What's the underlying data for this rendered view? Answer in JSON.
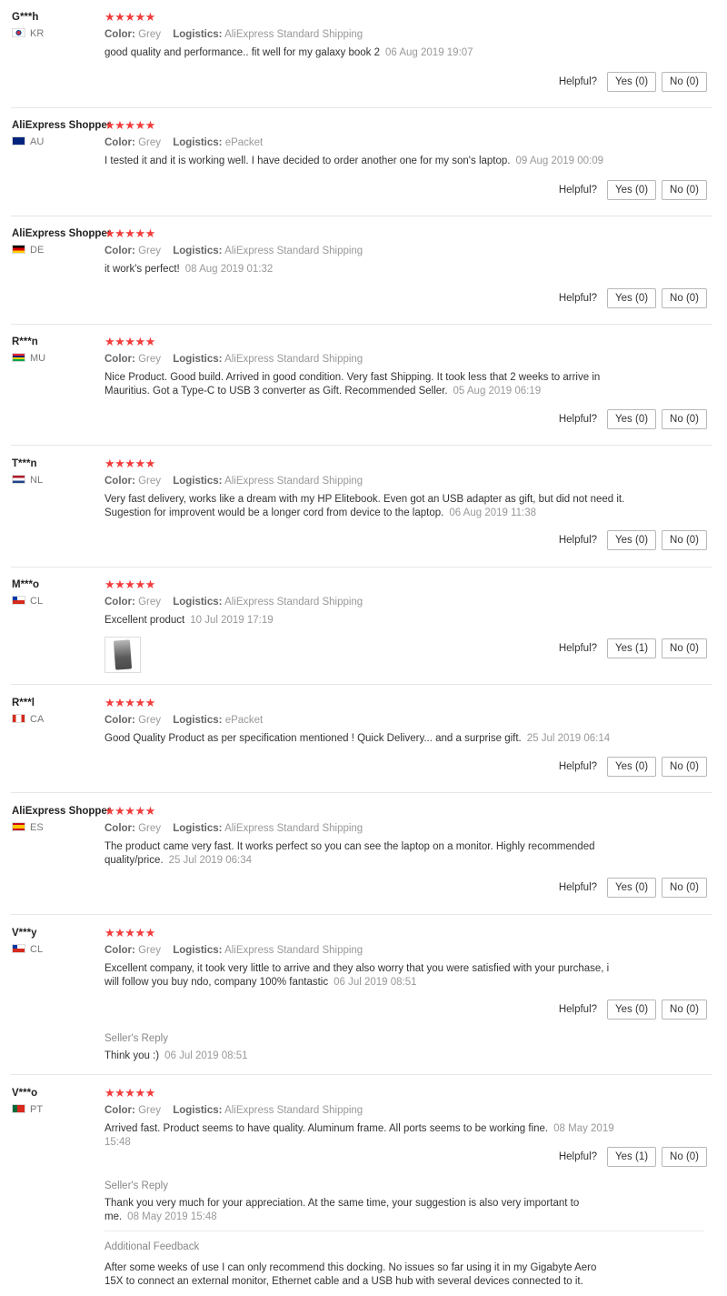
{
  "helpful_label": "Helpful?",
  "logistics_label": "Logistics:",
  "color_label": "Color:",
  "star_glyphs": "★★★★★",
  "reviews": [
    {
      "user": "G***h",
      "country": "KR",
      "flag": "kr",
      "stars": 5,
      "color": "Grey",
      "logistics": "AliExpress Standard Shipping",
      "text": "good quality and performance.. fit well for my galaxy book 2",
      "time": "06 Aug 2019 19:07",
      "yes": "Yes (0)",
      "no": "No (0)"
    },
    {
      "user": "AliExpress Shopper",
      "country": "AU",
      "flag": "au",
      "stars": 5,
      "color": "Grey",
      "logistics": "ePacket",
      "text": "I tested it and it is working well. I have decided to order another one for my son's laptop.",
      "time": "09 Aug 2019 00:09",
      "yes": "Yes (0)",
      "no": "No (0)"
    },
    {
      "user": "AliExpress Shopper",
      "country": "DE",
      "flag": "de",
      "stars": 5,
      "color": "Grey",
      "logistics": "AliExpress Standard Shipping",
      "text": "it work's perfect!",
      "time": "08 Aug 2019 01:32",
      "yes": "Yes (0)",
      "no": "No (0)"
    },
    {
      "user": "R***n",
      "country": "MU",
      "flag": "mu",
      "stars": 5,
      "color": "Grey",
      "logistics": "AliExpress Standard Shipping",
      "text": "Nice Product. Good build. Arrived in good condition. Very fast Shipping. It took less that 2 weeks to arrive in Mauritius. Got a Type-C to USB 3 converter as Gift. Recommended Seller.",
      "time": "05 Aug 2019 06:19",
      "yes": "Yes (0)",
      "no": "No (0)"
    },
    {
      "user": "T***n",
      "country": "NL",
      "flag": "nl",
      "stars": 5,
      "color": "Grey",
      "logistics": "AliExpress Standard Shipping",
      "text": "Very fast delivery, works like a dream with my HP Elitebook. Even got an USB adapter as gift, but did not need it. Sugestion for improvent would be a longer cord from device to the laptop.",
      "time": "06 Aug 2019 11:38",
      "yes": "Yes (0)",
      "no": "No (0)"
    },
    {
      "user": "M***o",
      "country": "CL",
      "flag": "cl",
      "stars": 5,
      "color": "Grey",
      "logistics": "AliExpress Standard Shipping",
      "text": "Excellent product",
      "time": "10 Jul 2019 17:19",
      "yes": "Yes (1)",
      "no": "No (0)"
    },
    {
      "user": "R***l",
      "country": "CA",
      "flag": "ca",
      "stars": 5,
      "color": "Grey",
      "logistics": "ePacket",
      "text": "Good Quality Product as per specification mentioned ! Quick Delivery... and a surprise gift.",
      "time": "25 Jul 2019 06:14",
      "yes": "Yes (0)",
      "no": "No (0)"
    },
    {
      "user": "AliExpress Shopper",
      "country": "ES",
      "flag": "es",
      "stars": 5,
      "color": "Grey",
      "logistics": "AliExpress Standard Shipping",
      "text": "The product came very fast. It works perfect so you can see the laptop on a monitor. Highly recommended quality/price.",
      "time": "25 Jul 2019 06:34",
      "yes": "Yes (0)",
      "no": "No (0)"
    },
    {
      "user": "V***y",
      "country": "CL",
      "flag": "cl",
      "stars": 5,
      "color": "Grey",
      "logistics": "AliExpress Standard Shipping",
      "text": "Excellent company, it took very little to arrive and they also worry that you were satisfied with your purchase, i will follow you buy ndo, company 100% fantastic",
      "time": "06 Jul 2019 08:51",
      "yes": "Yes (0)",
      "no": "No (0)",
      "seller_reply_title": "Seller's Reply",
      "seller_reply": "Think you :)",
      "seller_reply_time": "06 Jul 2019 08:51"
    },
    {
      "user": "V***o",
      "country": "PT",
      "flag": "pt",
      "stars": 5,
      "color": "Grey",
      "logistics": "AliExpress Standard Shipping",
      "text": "Arrived fast. Product seems to have quality. Aluminum frame. All ports seems to be working fine.",
      "time": "08 May 2019 15:48",
      "yes": "Yes (1)",
      "no": "No (0)",
      "seller_reply_title": "Seller's Reply",
      "seller_reply": "Thank you very much for your appreciation. At the same time, your suggestion is also very important to me.",
      "seller_reply_time": "08 May 2019 15:48",
      "additional_title": "Additional Feedback",
      "additional": "After some weeks of use I can only recommend this docking. No issues so far using it in my Gigabyte Aero 15X to connect an external monitor, Ethernet cable and a USB hub with several devices connected to it."
    }
  ]
}
